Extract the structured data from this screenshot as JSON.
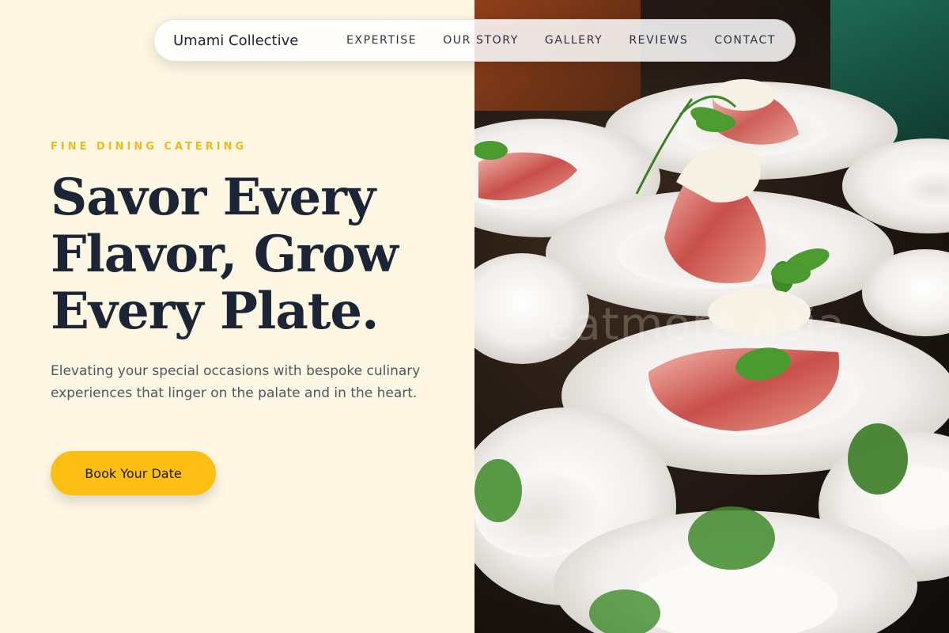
{
  "brand": {
    "name": "Umami Collective"
  },
  "nav": {
    "links": [
      "EXPERTISE",
      "OUR STORY",
      "GALLERY",
      "REVIEWS",
      "CONTACT"
    ]
  },
  "hero": {
    "eyebrow": "FINE DINING CATERING",
    "headline_lines": [
      "Savor Every",
      "Flavor, Grow",
      "Every Plate."
    ],
    "subtext": "Elevating your special occasions with bespoke culinary experiences that linger on the palate and in the heart.",
    "cta_label": "Book Your Date",
    "image_watermark": "eatmore.asia"
  },
  "colors": {
    "background": "#fdf7e3",
    "accent": "#fdbf14",
    "eyebrow": "#f3b81a",
    "heading": "#1c2535",
    "body_text": "#4f5662"
  }
}
